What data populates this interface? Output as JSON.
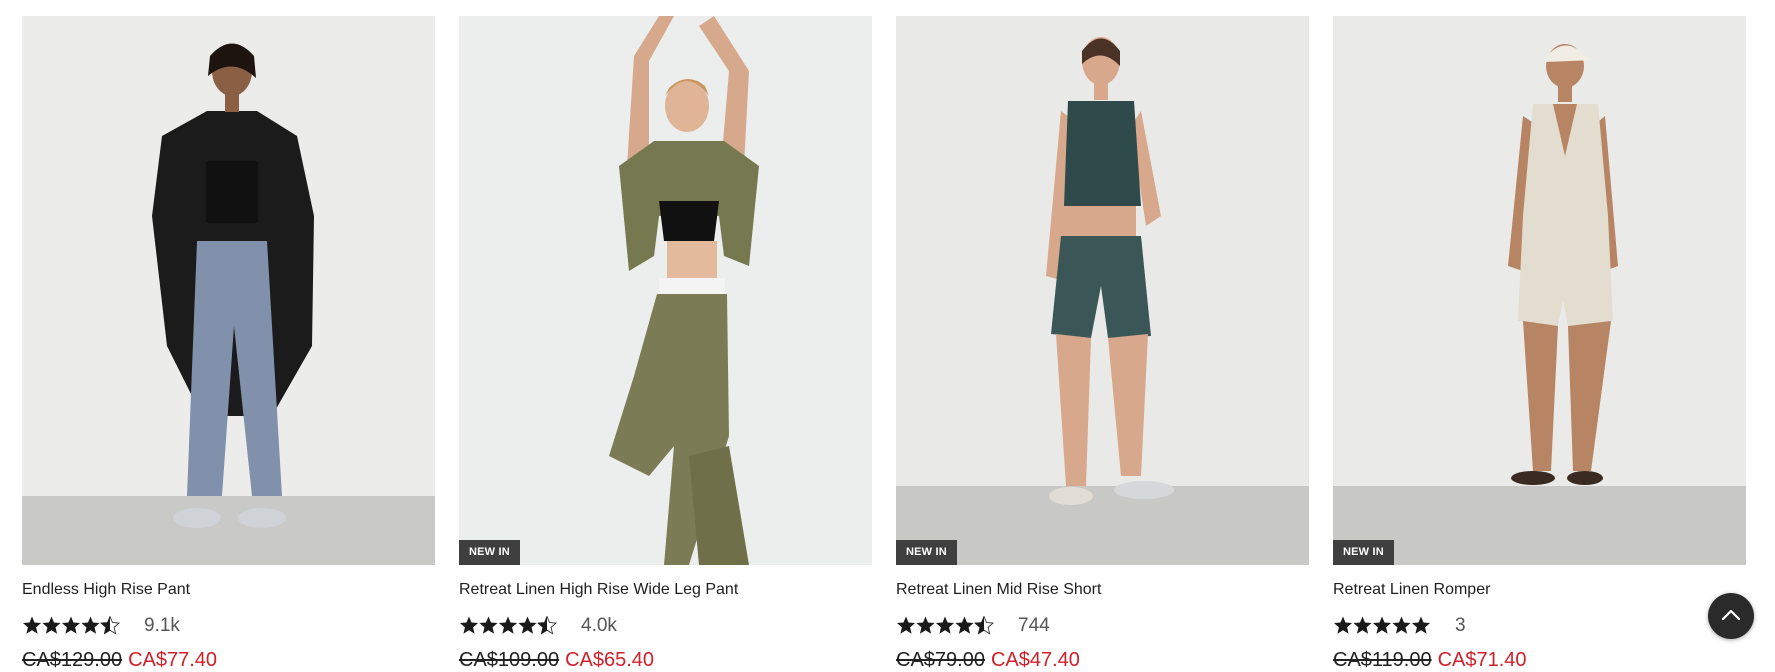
{
  "products": [
    {
      "name": "Endless High Rise Pant",
      "badge": "",
      "rating_value": 4.5,
      "rating_count": "9.1k",
      "original_price": "CA$129.00",
      "sale_price": "CA$77.40",
      "image_description_icon": "model-photo"
    },
    {
      "name": "Retreat Linen High Rise Wide Leg Pant",
      "badge": "NEW IN",
      "rating_value": 4.5,
      "rating_count": "4.0k",
      "original_price": "CA$109.00",
      "sale_price": "CA$65.40",
      "image_description_icon": "model-photo"
    },
    {
      "name": "Retreat Linen Mid Rise Short",
      "badge": "NEW IN",
      "rating_value": 4.5,
      "rating_count": "744",
      "original_price": "CA$79.00",
      "sale_price": "CA$47.40",
      "image_description_icon": "model-photo"
    },
    {
      "name": "Retreat Linen Romper",
      "badge": "NEW IN",
      "rating_value": 5,
      "rating_count": "3",
      "original_price": "CA$119.00",
      "sale_price": "CA$71.40",
      "image_description_icon": "model-photo"
    }
  ],
  "colors": {
    "sale": "#d0202a",
    "badge_bg": "#3f3f3f",
    "star": "#1a1a1a",
    "scroll_button": "#2a2a2a"
  },
  "scroll_top_icon": "chevron-up-icon"
}
